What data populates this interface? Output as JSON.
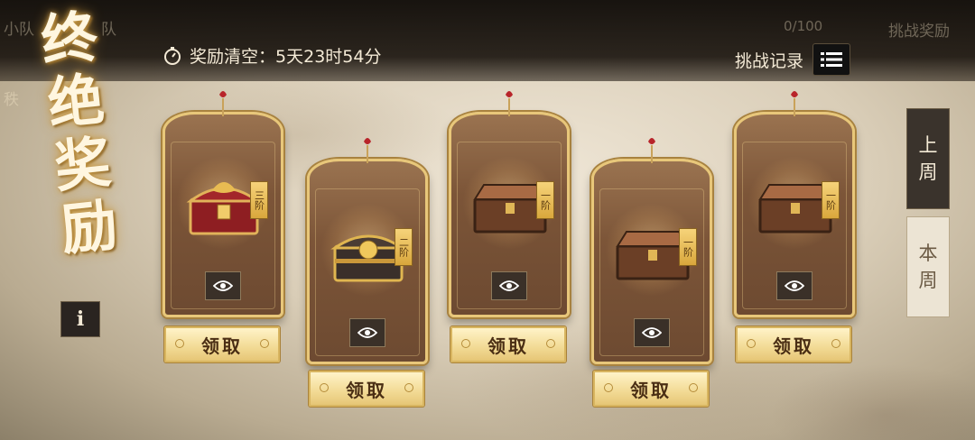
{
  "header": {
    "faint_left": "小队",
    "faint_left2": "队",
    "faint_coin_value": "0/100",
    "faint_challenge_reward": "挑战奖励",
    "faint_side": "秩",
    "timer_label": "奖励清空：",
    "timer_value": "5天23时54分",
    "history_label": "挑战记录",
    "icons": {
      "timer": "stopwatch-icon",
      "history": "list-icon"
    }
  },
  "title": {
    "line1": "终",
    "line2": "绝",
    "line3": "奖",
    "line4": "励"
  },
  "info_label": "i",
  "cards": [
    {
      "tier": "三阶",
      "chest": "red-dragon-chest",
      "claim_label": "领取"
    },
    {
      "tier": "二阶",
      "chest": "gold-dark-chest",
      "claim_label": "领取"
    },
    {
      "tier": "一阶",
      "chest": "wooden-chest",
      "claim_label": "领取"
    },
    {
      "tier": "一阶",
      "chest": "wooden-chest",
      "claim_label": "领取"
    },
    {
      "tier": "一阶",
      "chest": "wooden-chest",
      "claim_label": "领取"
    }
  ],
  "week_tabs": {
    "last": {
      "line1": "上",
      "line2": "周",
      "selected": true
    },
    "this": {
      "line1": "本",
      "line2": "周",
      "selected": false
    }
  },
  "colors": {
    "gold": "#e8c77a",
    "card_brown": "#7c5538",
    "claim_bg": "#f3dc98",
    "text_dark": "#4a2e14"
  }
}
